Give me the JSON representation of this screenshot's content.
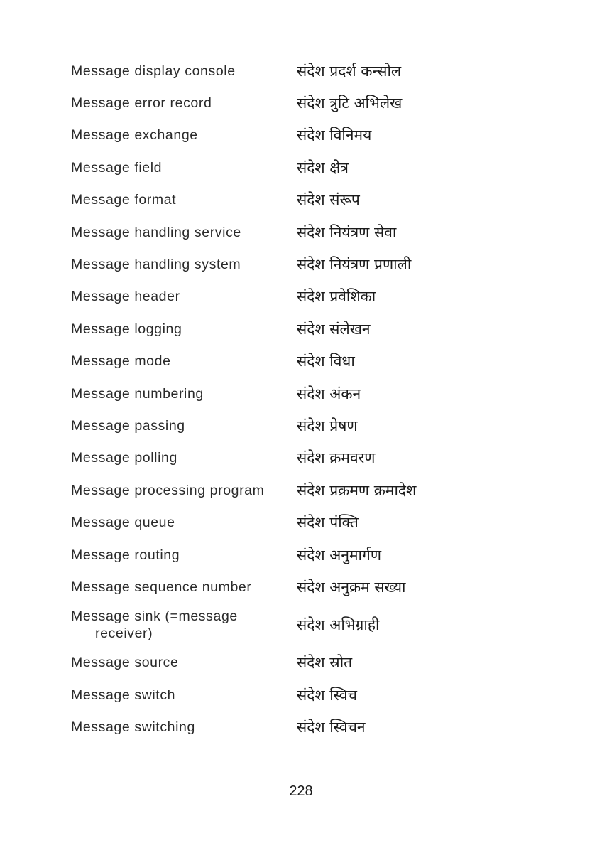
{
  "entries": [
    {
      "term": "Message display console",
      "translation": "संदेश प्रदर्श कन्सोल"
    },
    {
      "term": "Message error record",
      "translation": "संदेश त्रुटि अभिलेख"
    },
    {
      "term": "Message exchange",
      "translation": "संदेश विनिमय"
    },
    {
      "term": "Message field",
      "translation": "संदेश क्षेत्र"
    },
    {
      "term": "Message format",
      "translation": "संदेश संरूप"
    },
    {
      "term": "Message handling service",
      "translation": "संदेश नियंत्रण सेवा"
    },
    {
      "term": "Message handling system",
      "translation": "संदेश नियंत्रण प्रणाली"
    },
    {
      "term": "Message header",
      "translation": "संदेश प्रवेशिका"
    },
    {
      "term": "Message logging",
      "translation": "संदेश संलेखन"
    },
    {
      "term": "Message mode",
      "translation": "संदेश विधा"
    },
    {
      "term": "Message numbering",
      "translation": "संदेश अंकन"
    },
    {
      "term": "Message passing",
      "translation": "संदेश प्रेषण"
    },
    {
      "term": "Message polling",
      "translation": "संदेश क्रमवरण"
    },
    {
      "term": "Message processing program",
      "translation": "संदेश प्रक्रमण क्रमादेश"
    },
    {
      "term": "Message queue",
      "translation": "संदेश पंक्ति"
    },
    {
      "term": "Message routing",
      "translation": "संदेश अनुमार्गण"
    },
    {
      "term": "Message sequence number",
      "translation": "संदेश अनुक्रम सख्या"
    },
    {
      "term": "Message sink (=message",
      "term_cont": "receiver)",
      "translation": "संदेश अभिग्राही"
    },
    {
      "term": "Message source",
      "translation": "संदेश स्रोत"
    },
    {
      "term": "Message switch",
      "translation": "संदेश स्विच"
    },
    {
      "term": "Message switching",
      "translation": "संदेश स्विचन"
    }
  ],
  "page_number": "228"
}
